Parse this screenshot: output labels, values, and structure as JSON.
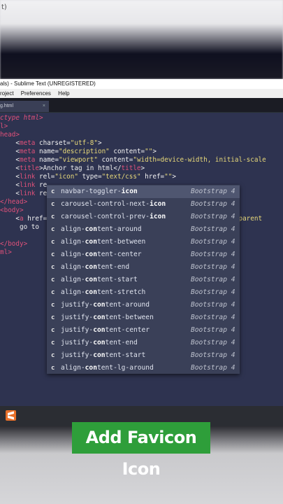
{
  "top_text": "t)",
  "window": {
    "title": "als) - Sublime Text (UNREGISTERED)",
    "menu": [
      "roject",
      "Preferences",
      "Help"
    ],
    "tab_label": "g.html",
    "tab_close": "×"
  },
  "code_lines": [
    [
      {
        "c": "doct",
        "t": "ctype html>"
      }
    ],
    [
      {
        "c": "tag",
        "t": "l>"
      }
    ],
    [
      {
        "c": "tag",
        "t": "head>"
      }
    ],
    [
      {
        "c": "plain",
        "t": "    <"
      },
      {
        "c": "tag",
        "t": "meta "
      },
      {
        "c": "attr",
        "t": "charset="
      },
      {
        "c": "str",
        "t": "\"utf-8\""
      },
      {
        "c": "plain",
        "t": ">"
      }
    ],
    [
      {
        "c": "plain",
        "t": "    <"
      },
      {
        "c": "tag",
        "t": "meta "
      },
      {
        "c": "attr",
        "t": "name="
      },
      {
        "c": "str",
        "t": "\"description\""
      },
      {
        "c": "attr",
        "t": " content="
      },
      {
        "c": "str",
        "t": "\"\""
      },
      {
        "c": "plain",
        "t": ">"
      }
    ],
    [
      {
        "c": "plain",
        "t": "    <"
      },
      {
        "c": "tag",
        "t": "meta "
      },
      {
        "c": "attr",
        "t": "name="
      },
      {
        "c": "str",
        "t": "\"viewport\""
      },
      {
        "c": "attr",
        "t": " content="
      },
      {
        "c": "str",
        "t": "\"width=device-width, initial-scale"
      }
    ],
    [
      {
        "c": "plain",
        "t": "    <"
      },
      {
        "c": "tag",
        "t": "title"
      },
      {
        "c": "plain",
        "t": ">Anchor tag in html</"
      },
      {
        "c": "tag",
        "t": "title"
      },
      {
        "c": "plain",
        "t": ">"
      }
    ],
    [
      {
        "c": "plain",
        "t": "    <"
      },
      {
        "c": "tag",
        "t": "link "
      },
      {
        "c": "attr",
        "t": "rel="
      },
      {
        "c": "str",
        "t": "\"icon\""
      },
      {
        "c": "attr",
        "t": " type="
      },
      {
        "c": "str",
        "t": "\"text/css\""
      },
      {
        "c": "attr",
        "t": " href="
      },
      {
        "c": "str",
        "t": "\"\""
      },
      {
        "c": "plain",
        "t": ">"
      }
    ],
    [
      {
        "c": "plain",
        "t": "    <"
      },
      {
        "c": "tag",
        "t": "link "
      },
      {
        "c": "attr",
        "t": "re"
      }
    ],
    [
      {
        "c": "plain",
        "t": "    <"
      },
      {
        "c": "tag",
        "t": "link "
      },
      {
        "c": "attr",
        "t": "re"
      }
    ],
    [
      {
        "c": "tag",
        "t": "</head>"
      }
    ],
    [
      {
        "c": "tag",
        "t": "<body>"
      }
    ],
    [
      {
        "c": "plain",
        "t": "    <"
      },
      {
        "c": "tag",
        "t": "a "
      },
      {
        "c": "attr",
        "t": "href="
      },
      {
        "c": "plain",
        "t": "                                              "
      },
      {
        "c": "str",
        "t": "=\"_parent"
      }
    ],
    [
      {
        "c": "plain",
        "t": "     go to"
      }
    ],
    [
      {
        "c": "plain",
        "t": ""
      }
    ],
    [
      {
        "c": "tag",
        "t": "</body>"
      }
    ],
    [
      {
        "c": "tag",
        "t": "ml>"
      }
    ]
  ],
  "autocomplete": [
    {
      "kind": "c",
      "pre": "navbar-toggler-",
      "bold": "icon",
      "post": "",
      "source": "Bootstrap 4",
      "selected": true
    },
    {
      "kind": "c",
      "pre": "carousel-control-next-",
      "bold": "icon",
      "post": "",
      "source": "Bootstrap 4"
    },
    {
      "kind": "c",
      "pre": "carousel-control-prev-",
      "bold": "icon",
      "post": "",
      "source": "Bootstrap 4"
    },
    {
      "kind": "c",
      "pre": "align-",
      "bold": "con",
      "post": "tent-around",
      "source": "Bootstrap 4"
    },
    {
      "kind": "c",
      "pre": "align-",
      "bold": "con",
      "post": "tent-between",
      "source": "Bootstrap 4"
    },
    {
      "kind": "c",
      "pre": "align-",
      "bold": "con",
      "post": "tent-center",
      "source": "Bootstrap 4"
    },
    {
      "kind": "c",
      "pre": "align-",
      "bold": "con",
      "post": "tent-end",
      "source": "Bootstrap 4"
    },
    {
      "kind": "c",
      "pre": "align-",
      "bold": "con",
      "post": "tent-start",
      "source": "Bootstrap 4"
    },
    {
      "kind": "c",
      "pre": "align-",
      "bold": "con",
      "post": "tent-stretch",
      "source": "Bootstrap 4"
    },
    {
      "kind": "c",
      "pre": "justify-",
      "bold": "con",
      "post": "tent-around",
      "source": "Bootstrap 4"
    },
    {
      "kind": "c",
      "pre": "justify-",
      "bold": "con",
      "post": "tent-between",
      "source": "Bootstrap 4"
    },
    {
      "kind": "c",
      "pre": "justify-",
      "bold": "con",
      "post": "tent-center",
      "source": "Bootstrap 4"
    },
    {
      "kind": "c",
      "pre": "justify-",
      "bold": "con",
      "post": "tent-end",
      "source": "Bootstrap 4"
    },
    {
      "kind": "c",
      "pre": "justify-",
      "bold": "con",
      "post": "tent-start",
      "source": "Bootstrap 4"
    },
    {
      "kind": "c",
      "pre": "align-",
      "bold": "con",
      "post": "tent-lg-around",
      "source": "Bootstrap 4"
    }
  ],
  "taskbar": {
    "icons": [
      "sublime-text-icon",
      "drop-icon"
    ]
  },
  "caption": "Add Favicon Icon",
  "colors": {
    "caption_bg": "#2e9e3a",
    "editor_bg": "#2e3350",
    "popup_bg": "#3a4058",
    "tag": "#e0517a",
    "string": "#e8d97a"
  }
}
